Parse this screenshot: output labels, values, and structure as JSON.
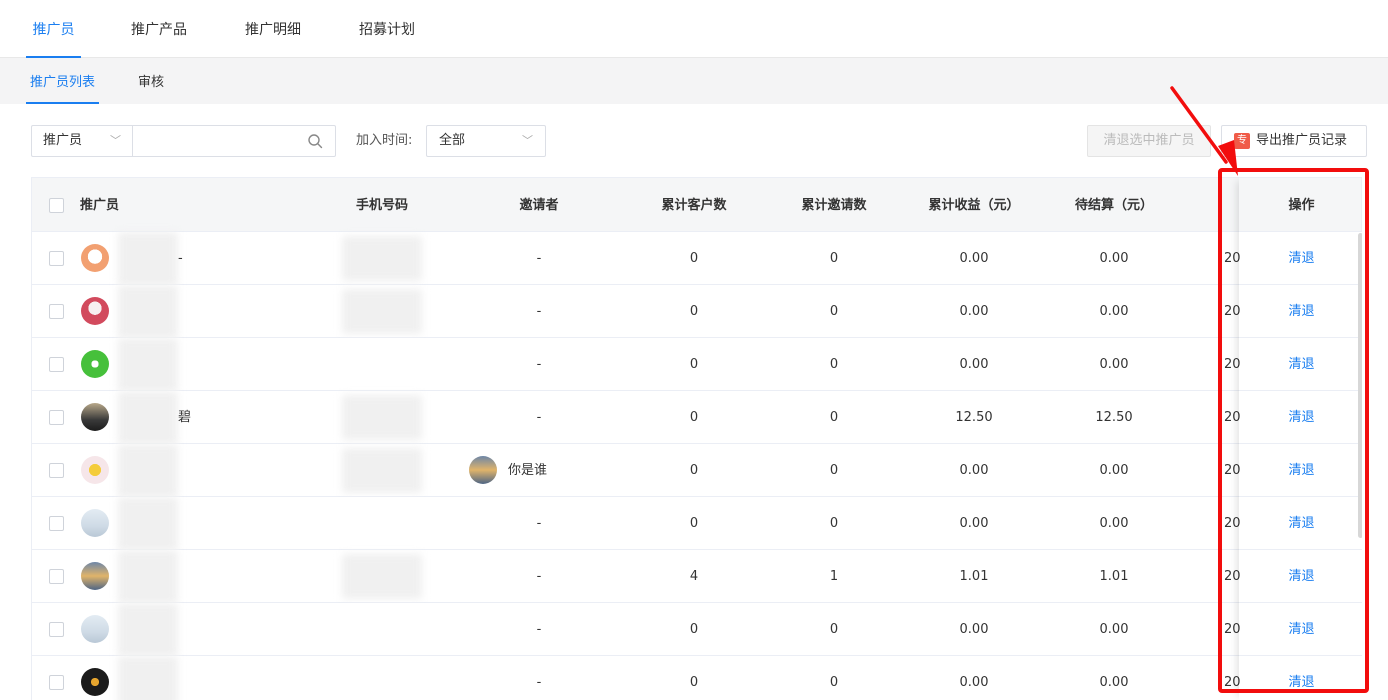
{
  "top_tabs": [
    "推广员",
    "推广产品",
    "推广明细",
    "招募计划"
  ],
  "sub_tabs": [
    "推广员列表",
    "审核"
  ],
  "filter": {
    "field_select": "推广员",
    "search_value": "",
    "time_label": "加入时间:",
    "time_select": "全部"
  },
  "buttons": {
    "clear_selected": "清退选中推广员",
    "export": "导出推广员记录",
    "export_icon_glyph": "专"
  },
  "table": {
    "headers": {
      "promoter": "推广员",
      "phone": "手机号码",
      "inviter": "邀请者",
      "customers": "累计客户数",
      "invites": "累计邀请数",
      "income": "累计收益（元）",
      "pending": "待结算（元）",
      "action": "操作"
    },
    "rows": [
      {
        "name": "-",
        "inviter": "-",
        "customers": "0",
        "invites": "0",
        "income": "0.00",
        "pending": "0.00",
        "date": "20",
        "action": "清退"
      },
      {
        "name": "",
        "inviter": "-",
        "customers": "0",
        "invites": "0",
        "income": "0.00",
        "pending": "0.00",
        "date": "20",
        "action": "清退"
      },
      {
        "name": "",
        "inviter": "-",
        "customers": "0",
        "invites": "0",
        "income": "0.00",
        "pending": "0.00",
        "date": "20",
        "action": "清退"
      },
      {
        "name": "碧",
        "inviter": "-",
        "customers": "0",
        "invites": "0",
        "income": "12.50",
        "pending": "12.50",
        "date": "20",
        "action": "清退"
      },
      {
        "name": "",
        "inviter": "你是谁",
        "customers": "0",
        "invites": "0",
        "income": "0.00",
        "pending": "0.00",
        "date": "20",
        "action": "清退"
      },
      {
        "name": "",
        "inviter": "-",
        "customers": "0",
        "invites": "0",
        "income": "0.00",
        "pending": "0.00",
        "date": "20",
        "action": "清退"
      },
      {
        "name": "",
        "inviter": "-",
        "customers": "4",
        "invites": "1",
        "income": "1.01",
        "pending": "1.01",
        "date": "20",
        "action": "清退"
      },
      {
        "name": "",
        "inviter": "-",
        "customers": "0",
        "invites": "0",
        "income": "0.00",
        "pending": "0.00",
        "date": "20",
        "action": "清退"
      },
      {
        "name": "",
        "inviter": "-",
        "customers": "0",
        "invites": "0",
        "income": "0.00",
        "pending": "0.00",
        "date": "20",
        "action": "清退"
      }
    ]
  },
  "colors": {
    "accent": "#1a7ef0",
    "annotation": "#f20d0d",
    "export_icon": "#f05b48"
  }
}
